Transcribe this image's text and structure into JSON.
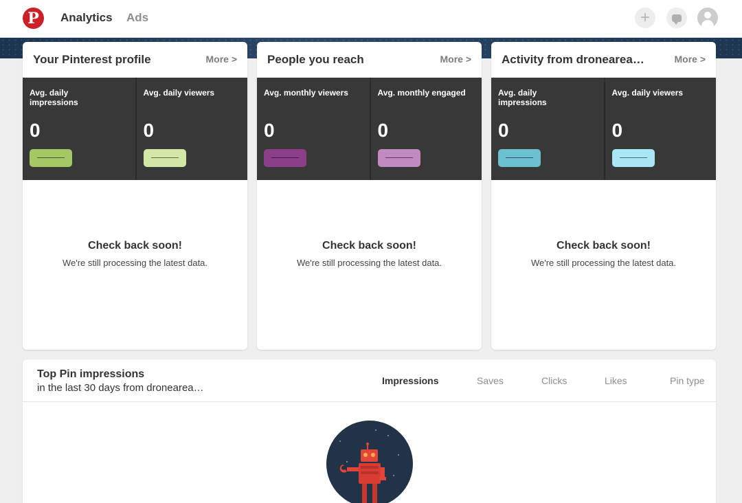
{
  "header": {
    "logo_letter": "P",
    "nav": [
      {
        "label": "Analytics",
        "active": true
      },
      {
        "label": "Ads",
        "active": false
      }
    ],
    "add_glyph": "+",
    "icons": [
      "plus-icon",
      "messages-icon",
      "profile-avatar-icon"
    ]
  },
  "cards": [
    {
      "title": "Your Pinterest profile",
      "more": "More >",
      "metrics": [
        {
          "label": "Avg. daily impressions",
          "value": "0",
          "color": "#a6c864"
        },
        {
          "label": "Avg. daily viewers",
          "value": "0",
          "color": "#d3e8a6"
        }
      ],
      "message_title": "Check back soon!",
      "message_sub": "We're still processing the latest data."
    },
    {
      "title": "People you reach",
      "more": "More >",
      "metrics": [
        {
          "label": "Avg. monthly viewers",
          "value": "0",
          "color": "#8b3f88"
        },
        {
          "label": "Avg. monthly engaged",
          "value": "0",
          "color": "#c18ac0"
        }
      ],
      "message_title": "Check back soon!",
      "message_sub": "We're still processing the latest data."
    },
    {
      "title": "Activity from dronearea…",
      "more": "More >",
      "metrics": [
        {
          "label": "Avg. daily impressions",
          "value": "0",
          "color": "#6cc0cf"
        },
        {
          "label": "Avg. daily viewers",
          "value": "0",
          "color": "#a9e7f4"
        }
      ],
      "message_title": "Check back soon!",
      "message_sub": "We're still processing the latest data."
    }
  ],
  "top_pins": {
    "title": "Top Pin impressions",
    "subtitle": "in the last 30 days from dronearea…",
    "tabs": [
      {
        "label": "Impressions",
        "active": true
      },
      {
        "label": "Saves",
        "active": false
      },
      {
        "label": "Clicks",
        "active": false
      },
      {
        "label": "Likes",
        "active": false
      },
      {
        "label": "Pin type",
        "active": false
      }
    ]
  }
}
